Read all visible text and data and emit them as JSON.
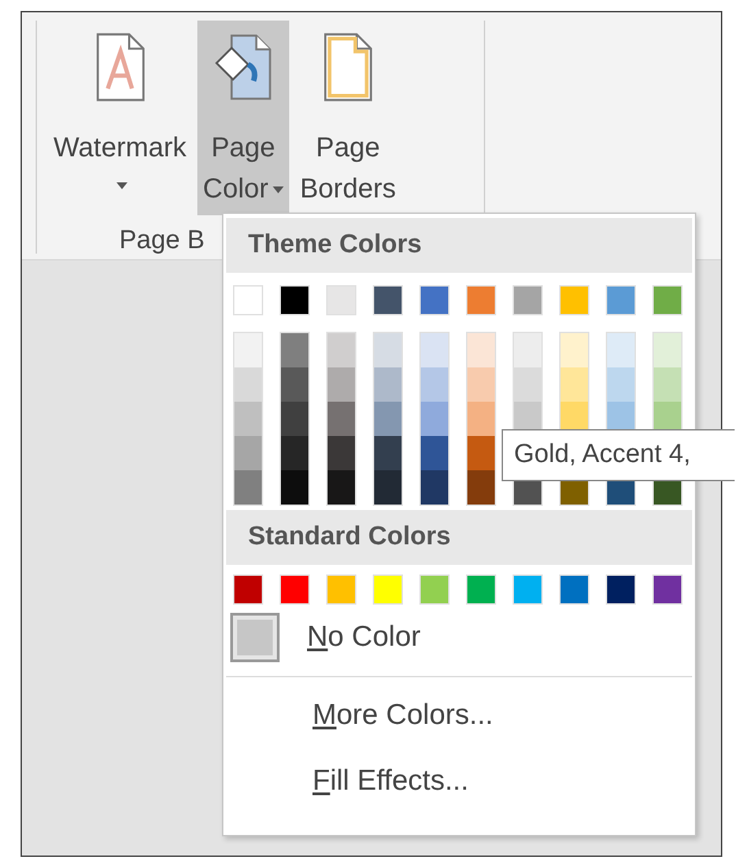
{
  "ribbon": {
    "buttons": [
      {
        "kind": "watermark",
        "lines": [
          "Watermark"
        ],
        "dropdown": true,
        "selected": false
      },
      {
        "kind": "page_color",
        "lines": [
          "Page",
          "Color"
        ],
        "dropdown": true,
        "selected": true
      },
      {
        "kind": "page_borders",
        "lines": [
          "Page",
          "Borders"
        ],
        "dropdown": false,
        "selected": false
      }
    ],
    "group_label": "Page B"
  },
  "menu": {
    "theme_header": "Theme Colors",
    "theme_colors": [
      {
        "color": "#ffffff",
        "shades": [
          {
            "color": "#f2f2f2"
          },
          {
            "color": "#d9d9d9"
          },
          {
            "color": "#bfbfbf"
          },
          {
            "color": "#a6a6a6"
          },
          {
            "color": "#808080"
          }
        ]
      },
      {
        "color": "#000000",
        "shades": [
          {
            "color": "#7f7f7f"
          },
          {
            "color": "#595959"
          },
          {
            "color": "#404040"
          },
          {
            "color": "#262626"
          },
          {
            "color": "#0d0d0d"
          }
        ]
      },
      {
        "color": "#e7e6e6",
        "shades": [
          {
            "color": "#d0cece"
          },
          {
            "color": "#aeabab"
          },
          {
            "color": "#767171"
          },
          {
            "color": "#3b3838"
          },
          {
            "color": "#181717"
          }
        ]
      },
      {
        "color": "#44546a",
        "shades": [
          {
            "color": "#d6dce4"
          },
          {
            "color": "#adb9ca"
          },
          {
            "color": "#8497b0"
          },
          {
            "color": "#333f4f"
          },
          {
            "color": "#222a35"
          }
        ]
      },
      {
        "color": "#4472c4",
        "shades": [
          {
            "color": "#dae3f3"
          },
          {
            "color": "#b4c7e7"
          },
          {
            "color": "#8faadc"
          },
          {
            "color": "#2f5597"
          },
          {
            "color": "#203864"
          }
        ]
      },
      {
        "color": "#ed7d31",
        "shades": [
          {
            "color": "#fbe5d6"
          },
          {
            "color": "#f8cbad"
          },
          {
            "color": "#f4b183"
          },
          {
            "color": "#c55a11"
          },
          {
            "color": "#843c0c"
          }
        ]
      },
      {
        "color": "#a5a5a5",
        "shades": [
          {
            "color": "#ededed"
          },
          {
            "color": "#dbdbdb"
          },
          {
            "color": "#c9c9c9"
          },
          {
            "covered": true
          },
          {
            "color": "#525252"
          }
        ]
      },
      {
        "color": "#ffc000",
        "shades": [
          {
            "color": "#fff2cc"
          },
          {
            "color": "#ffe699"
          },
          {
            "color": "#ffd966"
          },
          {
            "covered": true
          },
          {
            "color": "#7f6000"
          }
        ]
      },
      {
        "color": "#5b9bd5",
        "shades": [
          {
            "color": "#deebf7"
          },
          {
            "color": "#bdd7ee"
          },
          {
            "color": "#9dc3e6"
          },
          {
            "covered": true
          },
          {
            "color": "#1f4e79"
          }
        ]
      },
      {
        "color": "#70ad47",
        "shades": [
          {
            "color": "#e2f0d9"
          },
          {
            "color": "#c5e0b4"
          },
          {
            "color": "#a9d18e"
          },
          {
            "covered": true
          },
          {
            "color": "#385723"
          }
        ]
      }
    ],
    "standard_header": "Standard Colors",
    "standard_colors": [
      {
        "color": "#c00000"
      },
      {
        "color": "#ff0000"
      },
      {
        "color": "#ffc000"
      },
      {
        "color": "#ffff00"
      },
      {
        "color": "#92d050"
      },
      {
        "color": "#00b050"
      },
      {
        "color": "#00b0f0"
      },
      {
        "color": "#0070c0"
      },
      {
        "color": "#002060"
      },
      {
        "color": "#7030a0"
      }
    ],
    "items": [
      {
        "kind": "swatch",
        "access_key": "N",
        "label_rest": "o Color"
      },
      {
        "kind": "divider"
      },
      {
        "kind": "plain",
        "access_key": "M",
        "label_rest": "ore Colors..."
      },
      {
        "kind": "plain",
        "access_key": "F",
        "label_rest": "ill Effects..."
      }
    ]
  },
  "tooltip": {
    "text": "Gold, Accent 4,"
  }
}
